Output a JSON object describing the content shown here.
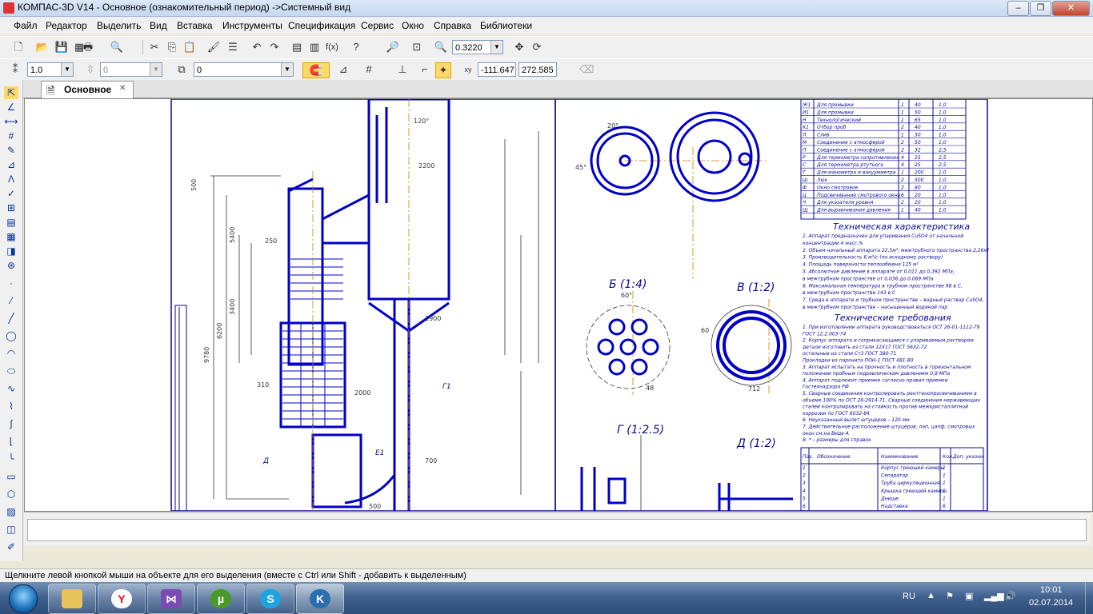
{
  "window": {
    "title": "КОМПАС-3D V14 - Основное (ознакомительный период) ->Системный вид",
    "btn_minimize": "–",
    "btn_restore": "❐",
    "btn_close": "✕"
  },
  "menu": [
    "Файл",
    "Редактор",
    "Выделить",
    "Вид",
    "Вставка",
    "Инструменты",
    "Спецификация",
    "Сервис",
    "Окно",
    "Справка",
    "Библиотеки"
  ],
  "toolbar1": {
    "zoom_value": "0.3220"
  },
  "toolbar2": {
    "line_width": "1.0",
    "layer_val": "0",
    "style_val": "0",
    "coord_x": "-111.647",
    "coord_y": "272.585"
  },
  "tabs": [
    {
      "label": "Основное",
      "close": "✕"
    }
  ],
  "drawing": {
    "view_b": "Б (1:4)",
    "view_v": "В (1:2)",
    "view_g": "Г (1:2.5)",
    "view_d": "Д (1:2)",
    "tech_char_title": "Техническая характеристика",
    "tech_req_title": "Технические требования",
    "tech_char_lines": [
      "1. Аппарат предназначен для упаривания CuSO4 от начальной",
      "   концентрации 4 масс.%",
      "2. Объем начальный аппарата 22,5м³; межтрубного пространства 2,26м³",
      "3. Производительность 6 м³/с (по исходному раствору)",
      "4. Площадь поверхности теплообмена 125 м²",
      "5. Абсолютное давление в аппарате от 0,011 до 0,392 МПа;",
      "   в межтрубном пространстве от 0,036 до 0,069 МПа",
      "6. Максимальная температура в трубном пространстве 98 в С,",
      "   в межтрубном пространстве 143 в С",
      "7. Среда в аппарате и трубном пространстве – водный раствор CuSO4,",
      "   в межтрубном пространстве – насыщенный водяной пар"
    ],
    "tech_req_lines": [
      "1. При изготовлении аппарата руководствоваться ОСТ 26-01-1112-79",
      "   ГОСТ 12.2.003-74",
      "2. Корпус аппарата и соприкасающиеся с упариваемым раствором",
      "   детали изготовить из стали 12Х17 ГОСТ 5632-72",
      "   остальные из стали Ст3 ГОСТ 380-71",
      "   Прокладки из паронита ПОН-1 ГОСТ 481-80",
      "3. Аппарат испытать на прочность и плотность в горизонтальном",
      "   положении пробным гидравлическим давлением 0,9 МПа",
      "4. Аппарат подлежит приемке согласно правил приемки",
      "   Гостехнадзора РФ",
      "5. Сварные соединения контролировать рентгенопросвечиванием в",
      "   объеме 100% по ОСТ 26-2914-71. Сварные соединения нержавеющих",
      "   сталей контролировать на стойкость против межкристаллитной",
      "   коррозии по ГОСТ 6032-84",
      "6. Неуказанный вылет штуцеров – 120 мм",
      "7. Действительное расположение штуцеров, лап, цапф, смотровых",
      "   окон см.на Виде А",
      "8. * – размеры для справок"
    ],
    "nozzle_table": [
      [
        "Ж1",
        "Для промывки",
        "1",
        "40",
        "1,0"
      ],
      [
        "И1",
        "Для промывки",
        "1",
        "50",
        "1,0"
      ],
      [
        "Н",
        "Технологический",
        "1",
        "65",
        "1,0"
      ],
      [
        "К1",
        "Отбор проб",
        "2",
        "40",
        "1,0"
      ],
      [
        "Л",
        "Слив",
        "1",
        "50",
        "1,0"
      ],
      [
        "М",
        "Соединение с атмосферой",
        "2",
        "50",
        "1,0"
      ],
      [
        "П",
        "Соединение с атмосферой",
        "2",
        "32",
        "2,5"
      ],
      [
        "Р",
        "Для термометра сопротивления",
        "4",
        "25",
        "2,5"
      ],
      [
        "С",
        "Для термометра ртутного",
        "4",
        "25",
        "2,5"
      ],
      [
        "Т",
        "Для манометра и вакуумметра",
        "1",
        "200",
        "1,0"
      ],
      [
        "Ш",
        "Люк",
        "2",
        "500",
        "1,0"
      ],
      [
        "Ф",
        "Окно смотровое",
        "2",
        "80",
        "1,0"
      ],
      [
        "Ц",
        "Подсвечивание смотрового окна",
        "6",
        "20",
        "1,0"
      ],
      [
        "Ч",
        "Для указателя уровня",
        "2",
        "20",
        "1,0"
      ],
      [
        "Щ",
        "Для выравнивания давления",
        "1",
        "40",
        "1,0"
      ]
    ],
    "spec_headers": [
      "Поз.",
      "Обозначение",
      "Наименование",
      "Кол.",
      "Доп. указан."
    ],
    "spec_rows": [
      [
        "1",
        "",
        "Корпус греющей камеры",
        "1",
        ""
      ],
      [
        "2",
        "",
        "Сепаратор",
        "1",
        ""
      ],
      [
        "3",
        "",
        "Труба циркуляционная",
        "1",
        ""
      ],
      [
        "4",
        "",
        "Крышка греющей камеры",
        "1",
        ""
      ],
      [
        "5",
        "",
        "Днище",
        "1",
        ""
      ],
      [
        "6",
        "",
        "Надставка",
        "6",
        ""
      ]
    ],
    "dims": [
      "500",
      "5400",
      "5500",
      "3400",
      "6200",
      "9780",
      "2200",
      "1900",
      "2000",
      "900",
      "700",
      "500",
      "310",
      "250",
      "60",
      "712",
      "48",
      "60°",
      "120°",
      "45°",
      "20°",
      "Г1",
      "Е1",
      "Д"
    ]
  },
  "status": "Щелкните левой кнопкой мыши на объекте для его выделения (вместе с Ctrl или Shift - добавить к выделенным)",
  "taskbar": {
    "apps": [
      "folder",
      "yandex",
      "visual-studio",
      "utorrent",
      "skype",
      "kompas"
    ],
    "lang": "RU",
    "time": "10:01",
    "date": "02.07.2014"
  }
}
